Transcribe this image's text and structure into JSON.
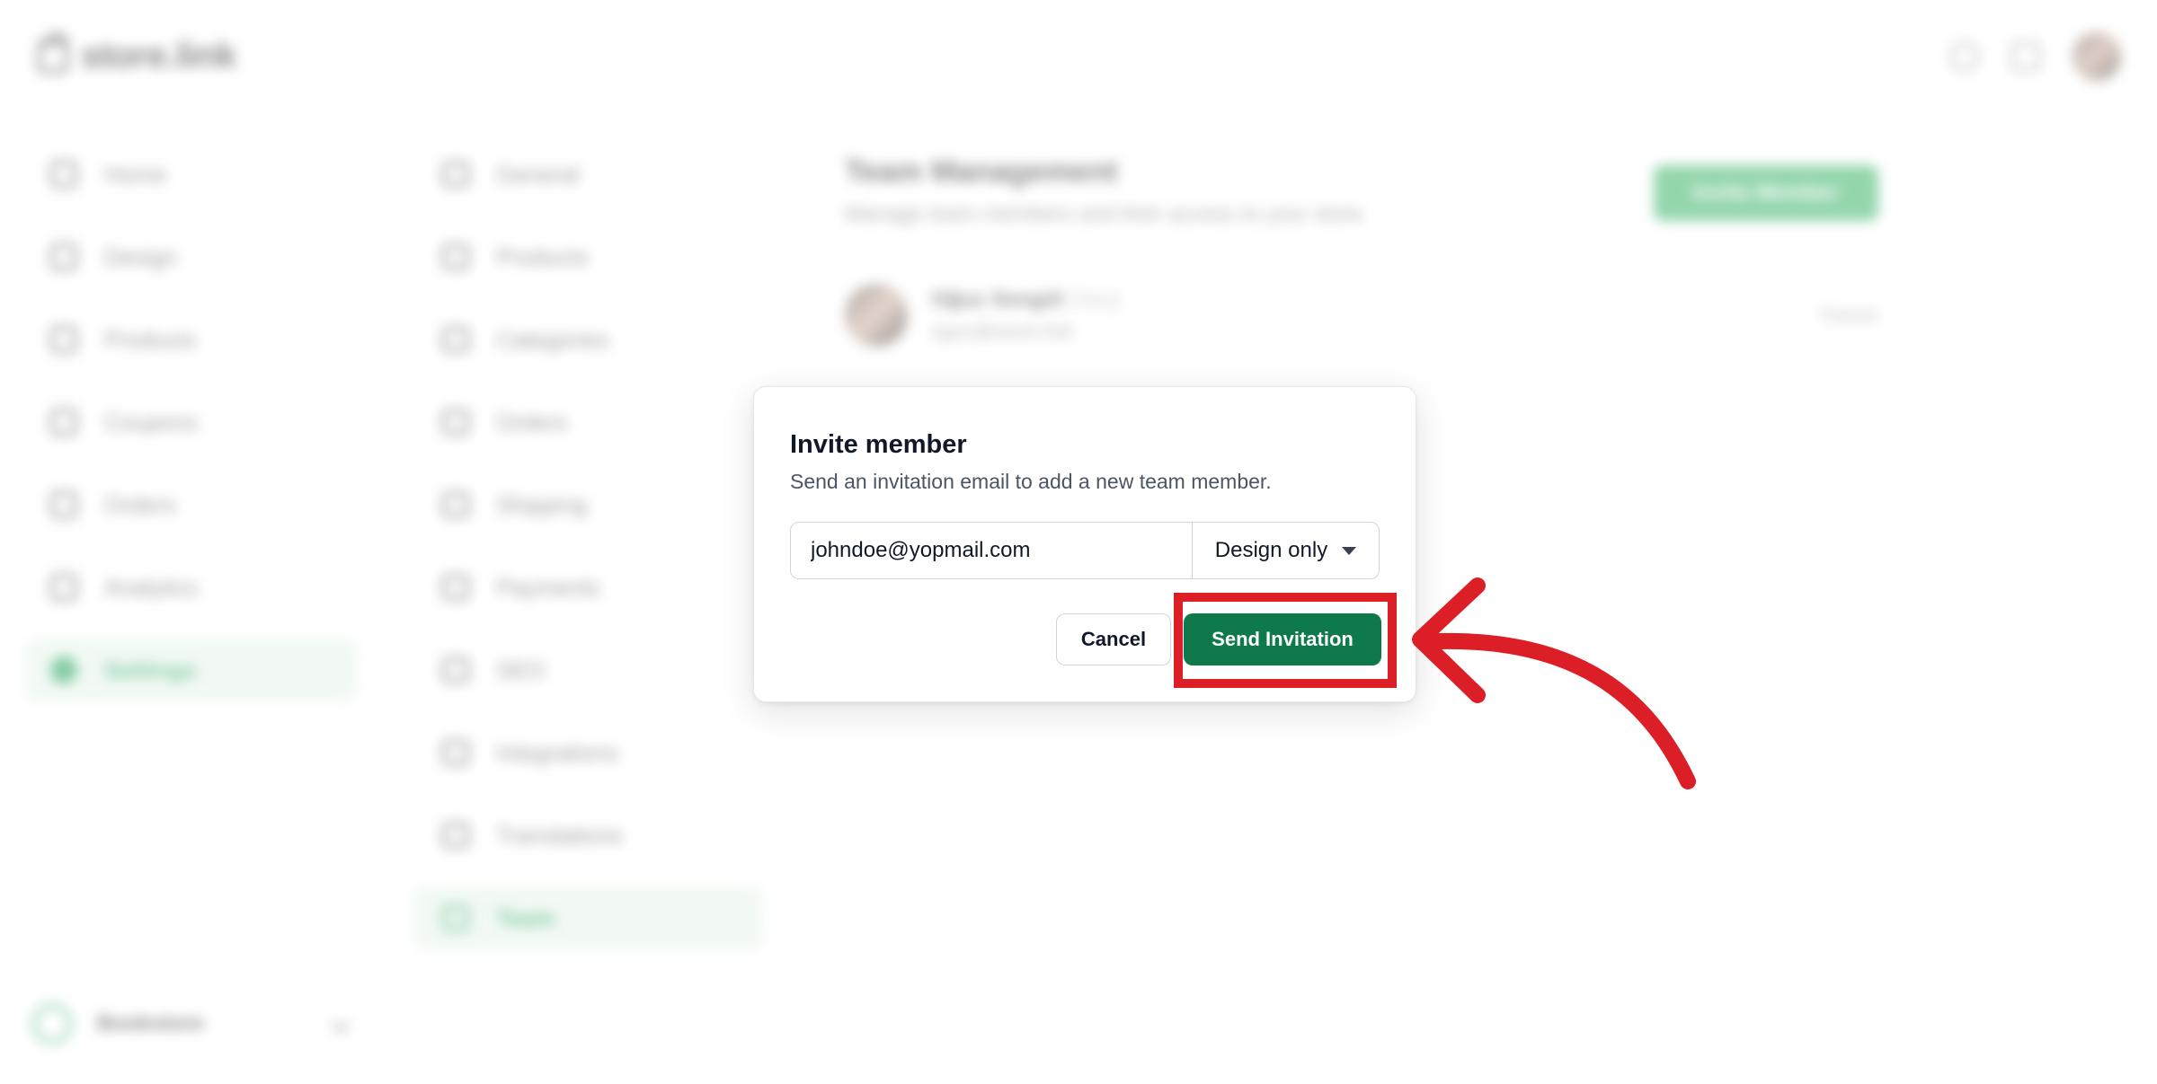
{
  "app": {
    "logo_text": "store.link"
  },
  "sidebar": {
    "items": [
      {
        "label": "Home"
      },
      {
        "label": "Design"
      },
      {
        "label": "Products"
      },
      {
        "label": "Coupons"
      },
      {
        "label": "Orders"
      },
      {
        "label": "Analytics"
      },
      {
        "label": "Settings",
        "active": true
      }
    ],
    "store_name": "Bookstore"
  },
  "settings_nav": {
    "items": [
      {
        "label": "General"
      },
      {
        "label": "Products"
      },
      {
        "label": "Categories"
      },
      {
        "label": "Orders"
      },
      {
        "label": "Shipping"
      },
      {
        "label": "Payments"
      },
      {
        "label": "SEO"
      },
      {
        "label": "Integrations"
      },
      {
        "label": "Translations"
      },
      {
        "label": "Team",
        "active": true
      }
    ]
  },
  "content": {
    "title": "Team Management",
    "subtitle": "Manage team members and their access to your store.",
    "invite_button": "Invite Member",
    "member": {
      "name": "Oğuz Sengül",
      "tag": "(You)",
      "email": "oguz@store.link",
      "role": "Owner"
    }
  },
  "modal": {
    "title": "Invite member",
    "description": "Send an invitation email to add a new team member.",
    "email_value": "johndoe@yopmail.com",
    "role_selected": "Design only",
    "cancel_label": "Cancel",
    "send_label": "Send Invitation"
  },
  "colors": {
    "primary": "#0e7a4b",
    "annotation": "#dc1f26",
    "accent_green": "#22a35a"
  }
}
